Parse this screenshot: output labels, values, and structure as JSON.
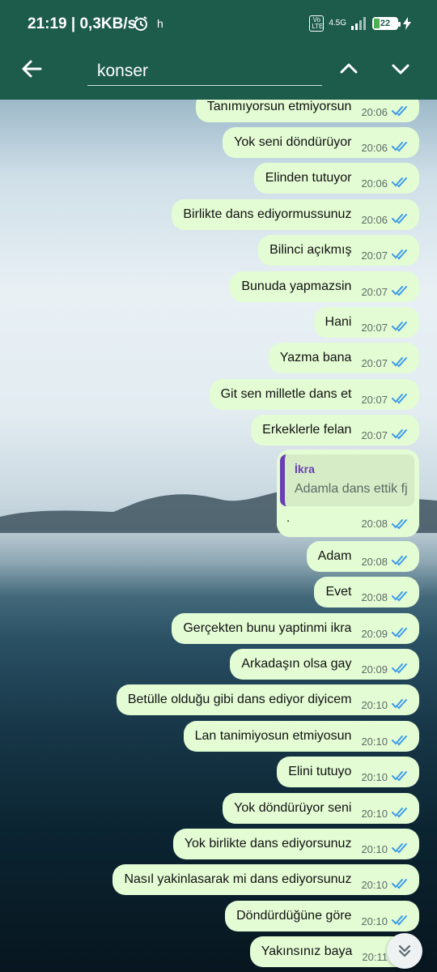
{
  "status": {
    "time": "21:19 | 0,3KB/s",
    "indicator": "h",
    "volte": "Vo LTE",
    "network": "4.5G",
    "battery": "22",
    "icons": [
      "alarm-icon",
      "signal-icon",
      "battery-icon",
      "charging-icon"
    ]
  },
  "search": {
    "query": "konser",
    "icons": [
      "back-arrow-icon",
      "chevron-up-icon",
      "chevron-down-icon"
    ]
  },
  "messages": [
    {
      "text": "Tanımıyorsun etmiyorsun",
      "time": "20:06"
    },
    {
      "text": "Yok seni döndürüyor",
      "time": "20:06"
    },
    {
      "text": "Elinden tutuyor",
      "time": "20:06"
    },
    {
      "text": "Birlikte dans ediyormussunuz",
      "time": "20:06"
    },
    {
      "text": "Bilinci açıkmış",
      "time": "20:07"
    },
    {
      "text": "Bunuda yapmazsin",
      "time": "20:07"
    },
    {
      "text": "Hani",
      "time": "20:07"
    },
    {
      "text": "Yazma bana",
      "time": "20:07"
    },
    {
      "text": "Git sen milletle dans et",
      "time": "20:07"
    },
    {
      "text": "Erkeklerle felan",
      "time": "20:07"
    },
    {
      "text": "Adam",
      "time": "20:08"
    },
    {
      "text": "Evet",
      "time": "20:08"
    },
    {
      "text": "Gerçekten bunu yaptinmi ikra",
      "time": "20:09"
    },
    {
      "text": "Arkadaşın olsa gay",
      "time": "20:09"
    },
    {
      "text": "Betülle olduğu gibi dans ediyor diyicem",
      "time": "20:10"
    },
    {
      "text": "Lan tanimiyosun etmiyosun",
      "time": "20:10"
    },
    {
      "text": "Elini tutuyo",
      "time": "20:10"
    },
    {
      "text": "Yok döndürüyor seni",
      "time": "20:10"
    },
    {
      "text": "Yok birlikte dans ediyorsunuz",
      "time": "20:10"
    },
    {
      "text": "Nasıl yakinlasarak mi dans ediyorsunuz",
      "time": "20:10"
    },
    {
      "text": "Döndürdüğüne göre",
      "time": "20:10"
    },
    {
      "text": "Yakınsınız baya",
      "time": "20:11"
    }
  ],
  "reply": {
    "quoted_name": "İkra",
    "quoted_text": "Adamla dans ettik fj",
    "body": ".",
    "time": "20:08"
  },
  "colors": {
    "header": "#1d5b4b",
    "bubble_out": "#e3fcd4",
    "read_ticks": "#3d9be9",
    "quote_accent": "#6a3fb4"
  }
}
